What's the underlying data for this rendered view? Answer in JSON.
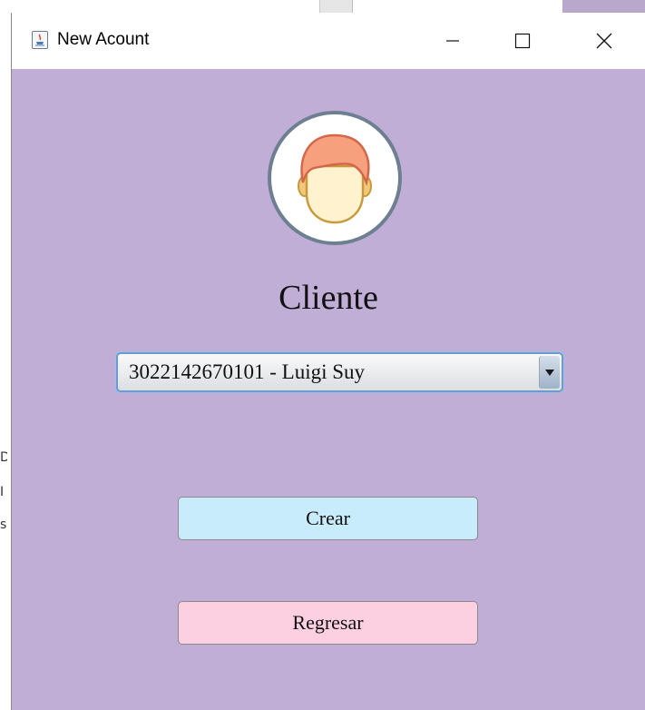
{
  "window": {
    "title": "New Acount",
    "controls": {
      "minimize_icon": "minimize-icon",
      "maximize_icon": "maximize-icon",
      "close_icon": "close-icon"
    },
    "background_color": "#c0aed6"
  },
  "background_fragments": {
    "left_glyphs": [
      "D",
      "I",
      "s"
    ]
  },
  "form": {
    "avatar_icon": "user-avatar-icon",
    "heading": "Cliente",
    "client_select": {
      "selected": "3022142670101 - Luigi Suy",
      "arrow_icon": "chevron-down-icon"
    },
    "create_button": {
      "label": "Crear",
      "color": "#c8ecfb"
    },
    "back_button": {
      "label": "Regresar",
      "color": "#fcd0e0"
    }
  }
}
